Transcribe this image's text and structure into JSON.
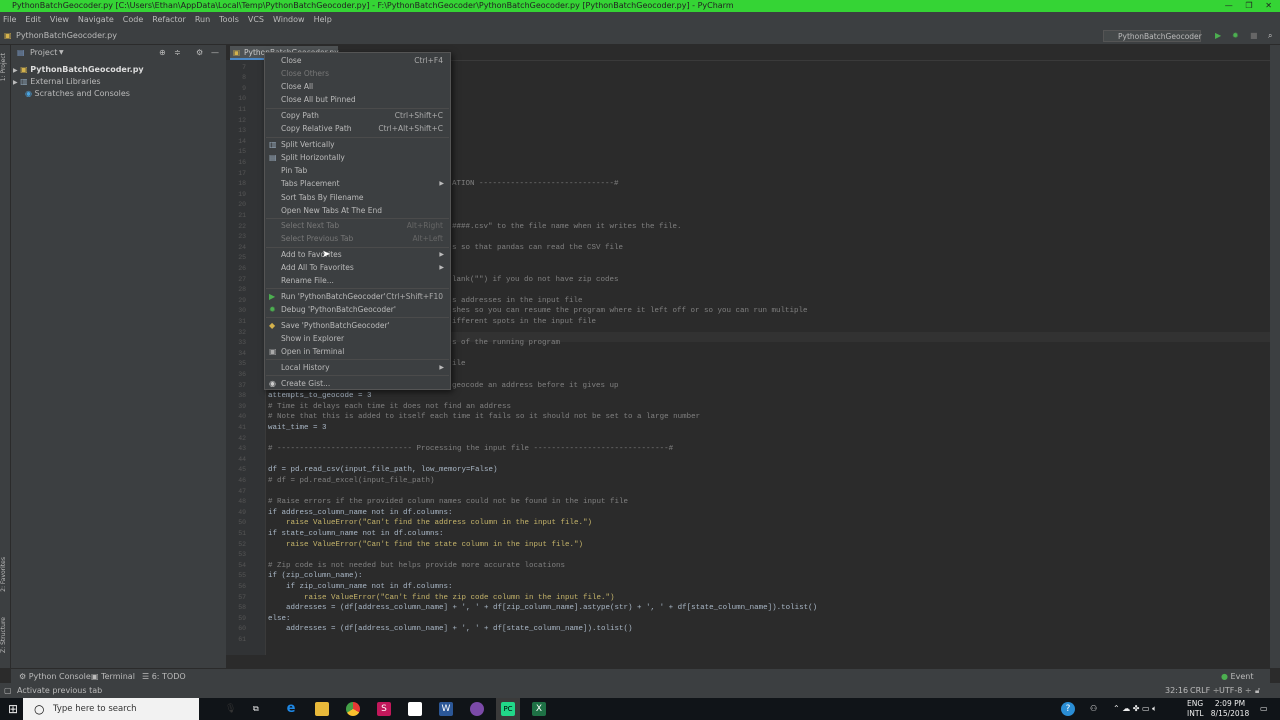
{
  "window": {
    "title": "PythonBatchGeocoder.py [C:\\Users\\Ethan\\AppData\\Local\\Temp\\PythonBatchGeocoder.py] - F:\\PythonBatchGeocoder\\PythonBatchGeocoder.py [PythonBatchGeocoder.py] - PyCharm",
    "title_bar_color": "#35d435"
  },
  "menubar": [
    "File",
    "Edit",
    "View",
    "Navigate",
    "Code",
    "Refactor",
    "Run",
    "Tools",
    "VCS",
    "Window",
    "Help"
  ],
  "navbar": {
    "breadcrumb": "PythonBatchGeocoder.py",
    "run_config": "PythonBatchGeocoder"
  },
  "left_stripe": {
    "project": "1: Project",
    "favorites": "2: Favorites",
    "structure": "Z: Structure"
  },
  "project_panel": {
    "title": "Project",
    "items": [
      {
        "label": "PythonBatchGeocoder.py",
        "icon": "python-file-icon"
      },
      {
        "label": "External Libraries",
        "icon": "library-icon"
      },
      {
        "label": "Scratches and Consoles",
        "icon": "scratches-icon"
      }
    ]
  },
  "editor": {
    "tab": "PythonBatchGeocoder.py",
    "line_numbers": [
      "7",
      "8",
      "9",
      "10",
      "11",
      "12",
      "13",
      "14",
      "15",
      "16",
      "17",
      "18",
      "19",
      "20",
      "21",
      "22",
      "23",
      "24",
      "25",
      "26",
      "27",
      "28",
      "29",
      "30",
      "31",
      "32",
      "33",
      "34",
      "35",
      "36",
      "37",
      "38",
      "39",
      "40",
      "41",
      "42",
      "43",
      "44",
      "45",
      "46",
      "47",
      "48",
      "49",
      "50",
      "51",
      "52",
      "53",
      "54",
      "55",
      "56",
      "57",
      "58",
      "59",
      "60",
      "61"
    ],
    "fragments": [
      {
        "line": "18",
        "text": "ATION ------------------------------#"
      },
      {
        "line": "22",
        "text": "####.csv\" to the file name when it writes the file."
      },
      {
        "line": "24",
        "text": "s so that pandas can read the CSV file"
      },
      {
        "line": "27",
        "text": "lank(\"\") if you do not have zip codes"
      },
      {
        "line": "29",
        "text": "s addresses in the input file"
      },
      {
        "line": "30",
        "text": "shes so you can resume the program where it left off or so you can run multiple"
      },
      {
        "line": "31",
        "text": "ifferent spots in the input file"
      },
      {
        "line": "33",
        "text": "s of the running program"
      },
      {
        "line": "35",
        "text": "ile"
      },
      {
        "line": "37",
        "text": "geocode an address before it gives up"
      }
    ],
    "code": [
      {
        "line": "38",
        "text": "attempts_to_geocode = 3"
      },
      {
        "line": "39",
        "text": "# Time it delays each time it does not find an address"
      },
      {
        "line": "40",
        "text": "# Note that this is added to itself each time it fails so it should not be set to a large number"
      },
      {
        "line": "41",
        "text": "wait_time = 3"
      },
      {
        "line": "43",
        "text": "# ------------------------------ Processing the input file ------------------------------#"
      },
      {
        "line": "45",
        "text": "df = pd.read_csv(input_file_path, low_memory=False)"
      },
      {
        "line": "46",
        "text": "# df = pd.read_excel(input_file_path)"
      },
      {
        "line": "48",
        "text": "# Raise errors if the provided column names could not be found in the input file"
      },
      {
        "line": "49",
        "text": "if address_column_name not in df.columns:"
      },
      {
        "line": "50",
        "text": "    raise ValueError(\"Can't find the address column in the input file.\")"
      },
      {
        "line": "51",
        "text": "if state_column_name not in df.columns:"
      },
      {
        "line": "52",
        "text": "    raise ValueError(\"Can't find the state column in the input file.\")"
      },
      {
        "line": "54",
        "text": "# Zip code is not needed but helps provide more accurate locations"
      },
      {
        "line": "55",
        "text": "if (zip_column_name):"
      },
      {
        "line": "56",
        "text": "    if zip_column_name not in df.columns:"
      },
      {
        "line": "57",
        "text": "        raise ValueError(\"Can't find the zip code column in the input file.\")"
      },
      {
        "line": "58",
        "text": "    addresses = (df[address_column_name] + ', ' + df[zip_column_name].astype(str) + ', ' + df[state_column_name]).tolist()"
      },
      {
        "line": "59",
        "text": "else:"
      },
      {
        "line": "60",
        "text": "    addresses = (df[address_column_name] + ', ' + df[state_column_name]).tolist()"
      }
    ]
  },
  "context_menu": [
    {
      "label": "Close",
      "shortcut": "Ctrl+F4"
    },
    {
      "label": "Close Others",
      "disabled": true
    },
    {
      "label": "Close All"
    },
    {
      "label": "Close All but Pinned"
    },
    {
      "label": "Copy Path",
      "shortcut": "Ctrl+Shift+C"
    },
    {
      "label": "Copy Relative Path",
      "shortcut": "Ctrl+Alt+Shift+C"
    },
    {
      "label": "Split Vertically",
      "icon": "split-vertical-icon"
    },
    {
      "label": "Split Horizontally",
      "icon": "split-horizontal-icon"
    },
    {
      "label": "Pin Tab"
    },
    {
      "label": "Tabs Placement",
      "submenu": true
    },
    {
      "label": "Sort Tabs By Filename"
    },
    {
      "label": "Open New Tabs At The End"
    },
    {
      "label": "Select Next Tab",
      "shortcut": "Alt+Right",
      "disabled": true
    },
    {
      "label": "Select Previous Tab",
      "shortcut": "Alt+Left",
      "disabled": true
    },
    {
      "label": "Add to Favorites",
      "submenu": true
    },
    {
      "label": "Add All To Favorites",
      "submenu": true
    },
    {
      "label": "Rename File..."
    },
    {
      "label": "Run 'PythonBatchGeocoder'",
      "shortcut": "Ctrl+Shift+F10",
      "icon": "run-icon"
    },
    {
      "label": "Debug 'PythonBatchGeocoder'",
      "icon": "debug-icon"
    },
    {
      "label": "Save 'PythonBatchGeocoder'",
      "icon": "python-icon"
    },
    {
      "label": "Show in Explorer"
    },
    {
      "label": "Open in Terminal",
      "icon": "terminal-icon"
    },
    {
      "label": "Local History",
      "submenu": true
    },
    {
      "label": "Create Gist...",
      "icon": "github-icon"
    }
  ],
  "bottom_tools": [
    "Python Console",
    "Terminal",
    "6: TODO"
  ],
  "event_log": "Event Log",
  "status": {
    "message": "Activate previous tab",
    "position": "32:16",
    "line_sep": "CRLF",
    "encoding": "UTF-8"
  },
  "taskbar": {
    "search_placeholder": "Type here to search",
    "lang1": "ENG",
    "lang2": "INTL",
    "time": "2:09 PM",
    "date": "8/15/2018"
  }
}
